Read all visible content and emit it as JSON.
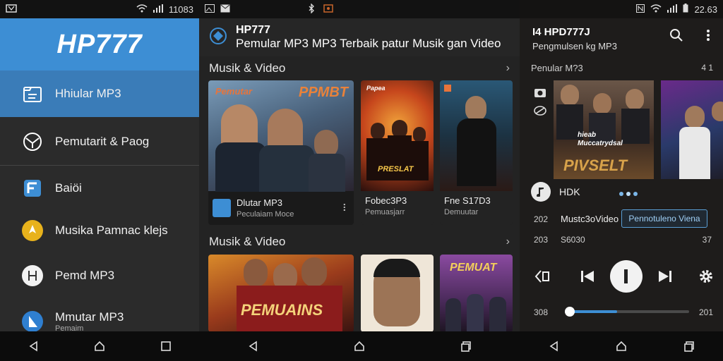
{
  "panel1": {
    "status": {
      "left_icon": "notification-icon",
      "clock": "11083"
    },
    "logo": "HP777",
    "items": [
      {
        "label": "Hhiular MP3",
        "icon": "document-icon",
        "active": true
      },
      {
        "label": "Pemutarit & Paog",
        "icon": "mail-clock-icon",
        "active": false
      },
      {
        "label": "Baiöi",
        "icon": "folder-icon",
        "active": false
      },
      {
        "label": "Musika Pamnac klejs",
        "icon": "upload-icon",
        "active": false
      },
      {
        "label": "Pemd MP3",
        "icon": "h-circle-icon",
        "active": false
      },
      {
        "label": "Mmutar MP3",
        "sub": "Pemaim",
        "icon": "play-triangle-icon",
        "active": false
      }
    ]
  },
  "panel2": {
    "app_title": "HP777",
    "app_subtitle": "Pemular MP3 MP3 Terbaik patur Musik gan Video",
    "section1": "Musik & Video",
    "section2": "Musik & Video",
    "cards_row1": [
      {
        "poster_top": "Pemutar",
        "poster_big": "PPMBT",
        "title": "Dlutar MP3",
        "sub": "Peculaiam Moce"
      },
      {
        "poster_top": "Papea",
        "poster_big": "PRESLAT",
        "title": "Fobec3P3",
        "sub": "Pemuasjarr"
      },
      {
        "poster_top": "",
        "poster_big": "",
        "title": "Fne S17D3",
        "sub": "Demuutar"
      }
    ],
    "cards_row2": [
      {
        "poster_big": "PEMUAINS"
      },
      {
        "poster_big": ""
      },
      {
        "poster_big": "PEMUAT"
      }
    ]
  },
  "panel3": {
    "status": {
      "clock": "22.63"
    },
    "app_title": "I4  HPD777J",
    "app_subtitle": "Pengmulsen kg MP3",
    "section": "Penular M?3",
    "section_count": "4 1",
    "poster_top": "hieab Muccatrydsal",
    "poster_big": "PIVSELT",
    "hdk_label": "HDK",
    "track_title": "Mustc3oVideo",
    "track_left1": "202",
    "track_left2": "203",
    "track_mid": "S6030",
    "track_right": "37",
    "chip_label": "Pennotuleno Viena",
    "time_elapsed": "308",
    "time_total": "201",
    "progress": 0.42
  }
}
